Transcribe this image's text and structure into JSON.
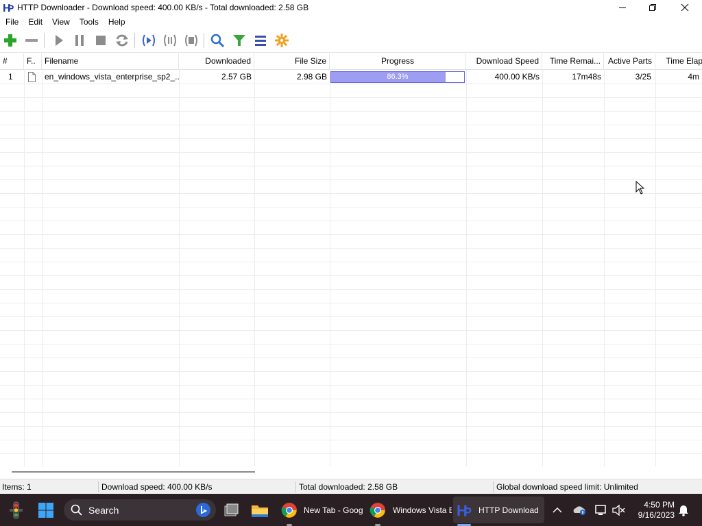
{
  "window": {
    "title": "HTTP Downloader - Download speed: 400.00 KB/s - Total downloaded: 2.58 GB"
  },
  "menu": [
    "File",
    "Edit",
    "View",
    "Tools",
    "Help"
  ],
  "toolbar": {
    "buttons": [
      "add-icon",
      "remove-icon",
      "start-icon",
      "pause-icon",
      "stop-icon",
      "restart-icon",
      "start-all-icon",
      "pause-all-icon",
      "stop-all-icon",
      "search-icon",
      "filter-icon",
      "list-icon",
      "options-icon"
    ]
  },
  "grid": {
    "columns": [
      "#",
      "F..",
      "Filename",
      "Downloaded",
      "File Size",
      "Progress",
      "Download Speed",
      "Time Remai...",
      "Active Parts",
      "Time Elaps"
    ],
    "rows": [
      {
        "num": "1",
        "filename": "en_windows_vista_enterprise_sp2_...",
        "downloaded": "2.57 GB",
        "file_size": "2.98 GB",
        "progress_text": "86.3%",
        "progress_value": 86.3,
        "speed": "400.00 KB/s",
        "time_remaining": "17m48s",
        "active_parts": "3/25",
        "time_elapsed": "4m"
      }
    ]
  },
  "status": {
    "items": "Items: 1",
    "speed": "Download speed: 400.00 KB/s",
    "total": "Total downloaded: 2.58 GB",
    "limit": "Global download speed limit: Unlimited"
  },
  "taskbar": {
    "search_label": "Search",
    "apps": [
      {
        "label": "New Tab - Goog"
      },
      {
        "label": "Windows Vista E"
      },
      {
        "label": "HTTP Download"
      }
    ],
    "time": "4:50 PM",
    "date": "9/16/2023"
  },
  "colors": {
    "progress_fill": "#9d9df3",
    "progress_border": "#6a6adb",
    "taskbar_bg": "#2a2024"
  }
}
